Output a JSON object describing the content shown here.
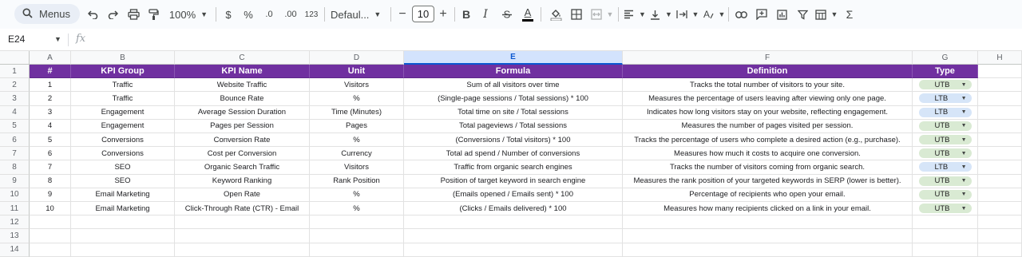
{
  "toolbar": {
    "menus_label": "Menus",
    "zoom": "100%",
    "currency": "$",
    "percent": "%",
    "decrease_decimal": ".0",
    "increase_decimal": ".00",
    "number_format": "123",
    "font_family": "Defaul...",
    "font_size": "10",
    "bold": "B",
    "italic": "I",
    "text_color_letter": "A",
    "text_color": "#000000",
    "sum": "Σ"
  },
  "formula_bar": {
    "name_box": "E24",
    "fx": "fx",
    "formula": ""
  },
  "columns": [
    "A",
    "B",
    "C",
    "D",
    "E",
    "F",
    "G",
    "H"
  ],
  "selected_column": "E",
  "row_numbers": [
    "1",
    "2",
    "3",
    "4",
    "5",
    "6",
    "7",
    "8",
    "9",
    "10",
    "11",
    "12",
    "13",
    "14"
  ],
  "header_row": [
    "#",
    "KPI Group",
    "KPI Name",
    "Unit",
    "Formula",
    "Definition",
    "Type"
  ],
  "colors": {
    "header_bg": "#7030a0",
    "utb_chip": "#d9ead3",
    "ltb_chip": "#d6e5f8",
    "selected_col": "#d3e3fd"
  },
  "rows": [
    {
      "num": "1",
      "group": "Traffic",
      "name": "Website Traffic",
      "unit": "Visitors",
      "formula": "Sum of all visitors over time",
      "definition": "Tracks the total number of visitors to your site.",
      "type": "UTB"
    },
    {
      "num": "2",
      "group": "Traffic",
      "name": "Bounce Rate",
      "unit": "%",
      "formula": "(Single-page sessions / Total sessions) * 100",
      "definition": "Measures the percentage of users leaving after viewing only one page.",
      "type": "LTB"
    },
    {
      "num": "3",
      "group": "Engagement",
      "name": "Average Session Duration",
      "unit": "Time (Minutes)",
      "formula": "Total time on site / Total sessions",
      "definition": "Indicates how long visitors stay on your website, reflecting engagement.",
      "type": "LTB"
    },
    {
      "num": "4",
      "group": "Engagement",
      "name": "Pages per Session",
      "unit": "Pages",
      "formula": "Total pageviews / Total sessions",
      "definition": "Measures the number of pages visited per session.",
      "type": "UTB"
    },
    {
      "num": "5",
      "group": "Conversions",
      "name": "Conversion Rate",
      "unit": "%",
      "formula": "(Conversions / Total visitors) * 100",
      "definition": "Tracks the percentage of users who complete a desired action (e.g., purchase).",
      "type": "UTB"
    },
    {
      "num": "6",
      "group": "Conversions",
      "name": "Cost per Conversion",
      "unit": "Currency",
      "formula": "Total ad spend / Number of conversions",
      "definition": "Measures how much it costs to acquire one conversion.",
      "type": "UTB"
    },
    {
      "num": "7",
      "group": "SEO",
      "name": "Organic Search Traffic",
      "unit": "Visitors",
      "formula": "Traffic from organic search engines",
      "definition": "Tracks the number of visitors coming from organic search.",
      "type": "LTB"
    },
    {
      "num": "8",
      "group": "SEO",
      "name": "Keyword Ranking",
      "unit": "Rank Position",
      "formula": "Position of target keyword in search engine",
      "definition": "Measures the rank position of your targeted keywords in SERP (lower is better).",
      "type": "UTB"
    },
    {
      "num": "9",
      "group": "Email Marketing",
      "name": "Open Rate",
      "unit": "%",
      "formula": "(Emails opened / Emails sent) * 100",
      "definition": "Percentage of recipients who open your email.",
      "type": "UTB"
    },
    {
      "num": "10",
      "group": "Email Marketing",
      "name": "Click-Through Rate (CTR) - Email",
      "unit": "%",
      "formula": "(Clicks / Emails delivered) * 100",
      "definition": "Measures how many recipients clicked on a link in your email.",
      "type": "UTB"
    }
  ]
}
